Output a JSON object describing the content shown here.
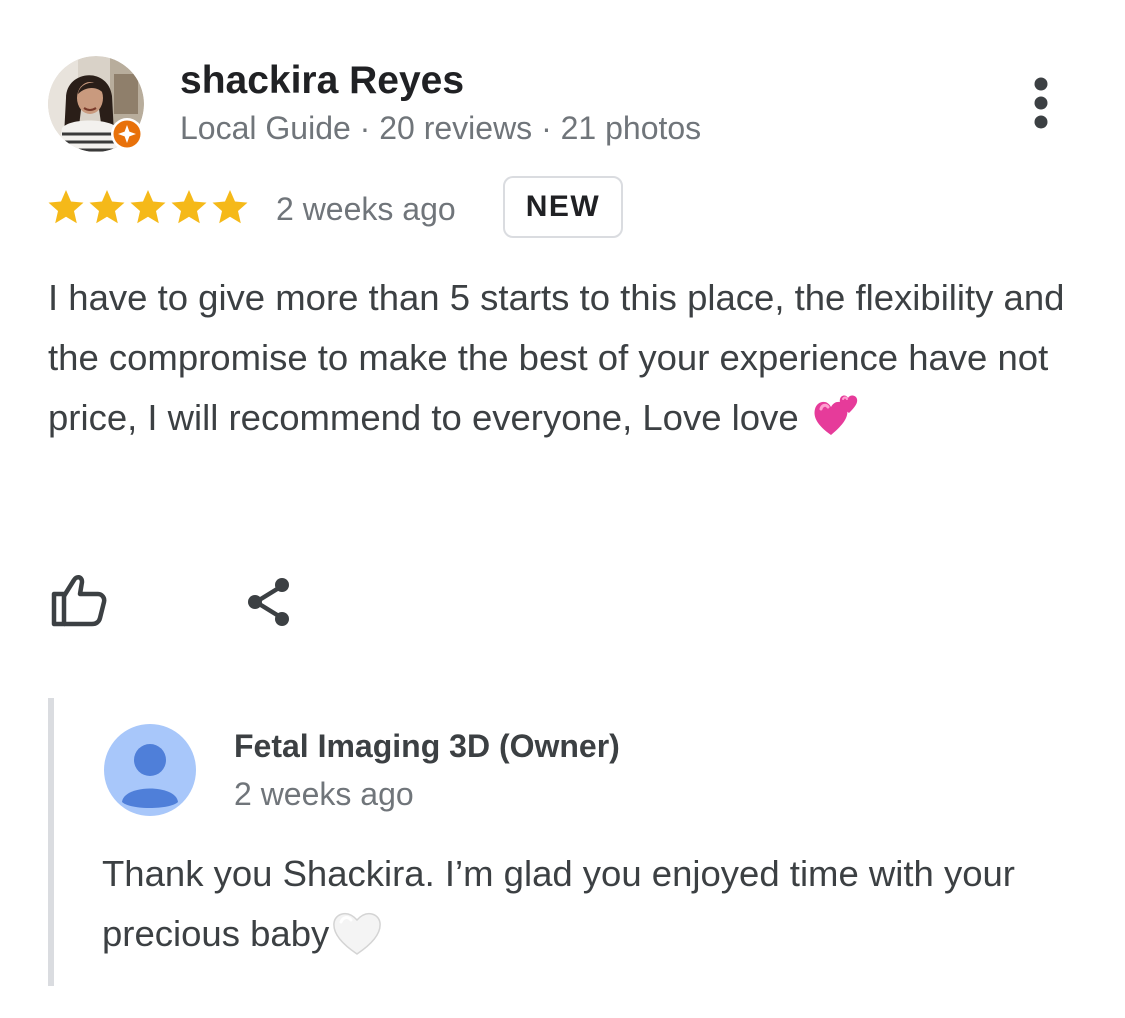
{
  "review": {
    "author_name": "shackira Reyes",
    "author_meta": "Local Guide · 20 reviews · 21 photos",
    "avatar_icon": "user-photo-avatar",
    "badge_icon": "local-guide-badge-icon",
    "rating": 5,
    "rating_max": 5,
    "date": "2 weeks ago",
    "new_badge": "NEW",
    "text": "I have to give more than 5 starts to this place, the flexibility and the compromise to make the best of your experience have not price, I will recommend to everyone, Love love",
    "text_emoji": "two-hearts-emoji",
    "actions": {
      "like_icon": "thumbs-up-icon",
      "share_icon": "share-icon",
      "more_icon": "more-vert-icon"
    }
  },
  "owner_reply": {
    "name": "Fetal Imaging 3D (Owner)",
    "date": "2 weeks ago",
    "text": "Thank you Shackira. I’m glad you enjoyed time with your precious baby",
    "text_emoji": "white-heart-emoji",
    "avatar_icon": "default-person-avatar-icon"
  },
  "colors": {
    "star": "#f5b919",
    "badge_orange": "#e8710a",
    "primary_text": "#202124",
    "secondary_text": "#70757a",
    "body_text": "#3c4043",
    "owner_avatar_bg": "#a8c7fa",
    "owner_avatar_fg": "#4f7fd9",
    "reply_bar": "#dadce0"
  }
}
